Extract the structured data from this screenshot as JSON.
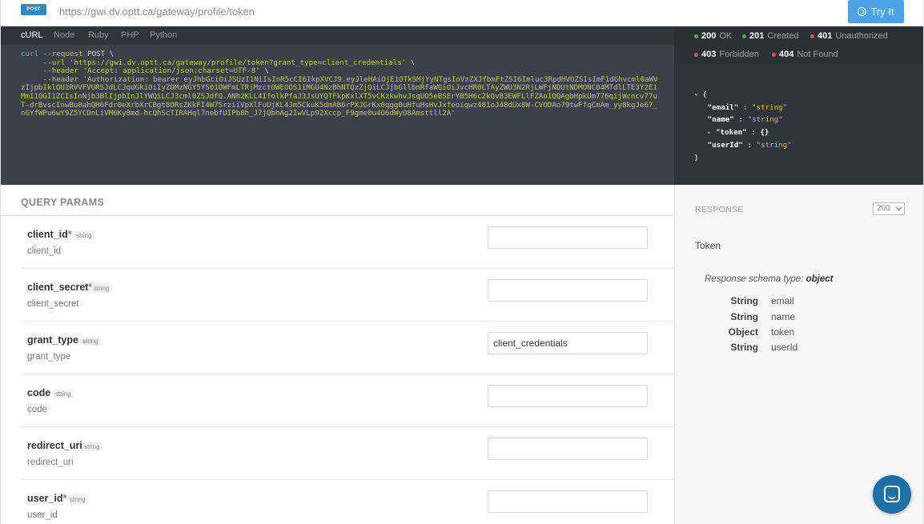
{
  "header": {
    "method": "POST",
    "url": "https://gwi.dv.optt.ca/gateway/profile/token",
    "try_label": "Try It"
  },
  "code_tabs": [
    "cURL",
    "Node",
    "Ruby",
    "PHP",
    "Python"
  ],
  "code": {
    "line1_cmd": "curl",
    "line1_flag": "--request",
    "line1_val": "POST",
    "line2_flag": "--url",
    "line2_val": "'https://gwi.dv.optt.ca/gateway/profile/token?grant_type=client_credentials'",
    "line3_flag": "--header",
    "line3_val": "'Accept: application/json;charset=UTF-8'",
    "line4_flag": "--header",
    "line4_val": "'Authorization: bearer eyJhbGciOiJSUzI1NiIsInR5cCI6IkpXVCJ9.eyJleHAiOjE1OTkSMjYyNTgsInVzZXJfbmFtZSI6Imluc3RpdHVOZSIsImF1dGhvcml0aWVzIjpbIklOU1RVVFVURSJdLCJqdGkiOiIyZDMzNGY5YS01OWFmLTRjMzctOWEOOS1iMGU4NzBhNTQzZjQiLCJjbGllbnRfaWQiOiJvcHR0LTAyZWU3N2RjLWFjNDUtNDMONC04MTdlLTE3Y2E1MmI1OGI1ZCIsInNjb3BlIjpbInJlYWQiLCJ3cml0ZSJdfQ.ANh2KLL4IfolkPfaJ3JsUYQTFkpKxlXT5vCKzkwhvJsqUO5eBSErYB5H6c2kQvB3EWFLlFZAo1QQAgbHpkUm776qijWcncv77uT-drBvscInwBu0ahQH6Fdr0eXrbXrCBgt8ORsZKkFI4W7SrziiVpXlFuUjKL4Jm5CkuK5dmAB6rPXJGrKx0qgg0uHfuHsHvJxfeoiqwz481oJ48dUx8W-CVODAo79twFfqCmAm_yy8kgJe67_nGYfWPu6wY9Z5YCDnLiVM6Ky8md-hcQhScTIRAHql7nebfUIPb8h_J7jQbhAg2IwVLp92Xccp_F9gme0u4O6dWyO8Amsttll2A'",
    "backslash": "\\"
  },
  "statuses": [
    {
      "code": "200",
      "text": "OK",
      "color": "#4caf50"
    },
    {
      "code": "201",
      "text": "Created",
      "color": "#4caf50"
    },
    {
      "code": "401",
      "text": "Unauthorized",
      "color": "#e05252"
    },
    {
      "code": "403",
      "text": "Forbidden",
      "color": "#e05252"
    },
    {
      "code": "404",
      "text": "Not Found",
      "color": "#e05252"
    }
  ],
  "json_preview": {
    "open": "{",
    "close": "}",
    "colon": ":",
    "fields": [
      {
        "key": "\"email\"",
        "value": "\"string\""
      },
      {
        "key": "\"name\"",
        "value": "\"string\""
      },
      {
        "key": "\"token\"",
        "value": "{}"
      },
      {
        "key": "\"userId\"",
        "value": "\"string\""
      }
    ]
  },
  "params": {
    "title": "QUERY PARAMS",
    "rows": [
      {
        "name": "client_id",
        "required": "*",
        "type": "string",
        "desc": "client_id",
        "value": ""
      },
      {
        "name": "client_secret",
        "required": "*",
        "type": "string",
        "desc": "client_secret",
        "value": ""
      },
      {
        "name": "grant_type",
        "required": "",
        "type": "string",
        "desc": "grant_type",
        "value": "client_credentials"
      },
      {
        "name": "code",
        "required": "",
        "type": "string",
        "desc": "code",
        "value": ""
      },
      {
        "name": "redirect_uri",
        "required": "",
        "type": "string",
        "desc": "redirect_uri",
        "value": ""
      },
      {
        "name": "user_id",
        "required": "*",
        "type": "string",
        "desc": "user_id",
        "value": ""
      }
    ]
  },
  "response": {
    "title": "RESPONSE",
    "selected_code": "200",
    "description": "Token",
    "schema_label": "Response schema type:",
    "schema_type": "object",
    "fields": [
      {
        "type": "String",
        "name": "email"
      },
      {
        "type": "String",
        "name": "name"
      },
      {
        "type": "Object",
        "name": "token"
      },
      {
        "type": "String",
        "name": "userId"
      }
    ]
  },
  "icons": {
    "try": "circle-arrow-icon",
    "chat": "chat-bubble-icon"
  }
}
